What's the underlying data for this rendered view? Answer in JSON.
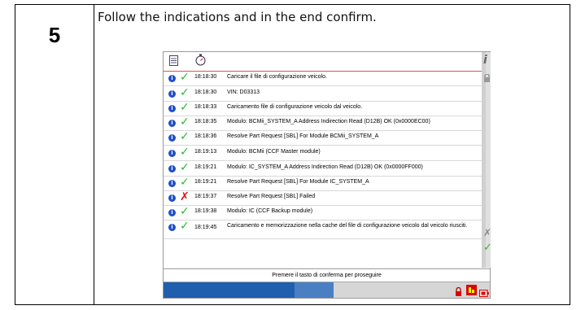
{
  "step": {
    "number": "5",
    "instruction": "Follow the indications and in the end confirm."
  },
  "log": {
    "rows": [
      {
        "status": "ok",
        "time": "18:18:30",
        "message": "Caricare il file di configurazione veicolo."
      },
      {
        "status": "ok",
        "time": "18:18:30",
        "message": "VIN: D03313"
      },
      {
        "status": "ok",
        "time": "18:18:33",
        "message": "Caricamento file di configurazione veicolo dal veicolo."
      },
      {
        "status": "ok",
        "time": "18:18:35",
        "message": "Modulo: BCMii_SYSTEM_A Address Indirection Read (D12B) OK (0x0000EC00)"
      },
      {
        "status": "ok",
        "time": "18:18:36",
        "message": "Resolve Part Request [SBL] For Module BCMii_SYSTEM_A"
      },
      {
        "status": "ok",
        "time": "18:19:13",
        "message": "Modulo: BCMii (CCF Master module)"
      },
      {
        "status": "ok",
        "time": "18:19:21",
        "message": "Modulo: IC_SYSTEM_A Address Indirection Read (D12B) OK (0x0000FF000)"
      },
      {
        "status": "ok",
        "time": "18:19:21",
        "message": "Resolve Part Request [SBL] For Module IC_SYSTEM_A"
      },
      {
        "status": "fail",
        "time": "18:19:37",
        "message": "Resolve Part Request [SBL] Failed"
      },
      {
        "status": "ok",
        "time": "18:19:38",
        "message": "Modulo: IC (CCF Backup module)"
      },
      {
        "status": "ok",
        "time": "18:19:45",
        "message": "Caricamento e memorizzazione nella cache del file di configurazione veicolo dal veicolo riusciti."
      }
    ]
  },
  "confirm_prompt": "Premere il tasto di conferma per proseguire",
  "icons": {
    "ok": "✓",
    "fail": "✗",
    "info": "i",
    "side_info": "i",
    "cancel": "✗",
    "confirm": "✓"
  },
  "colors": {
    "ok": "#2eb82e",
    "fail": "#e01010",
    "info": "#1f4fc4",
    "status_bar": "#1f5fae",
    "separator": "#d9534f"
  }
}
